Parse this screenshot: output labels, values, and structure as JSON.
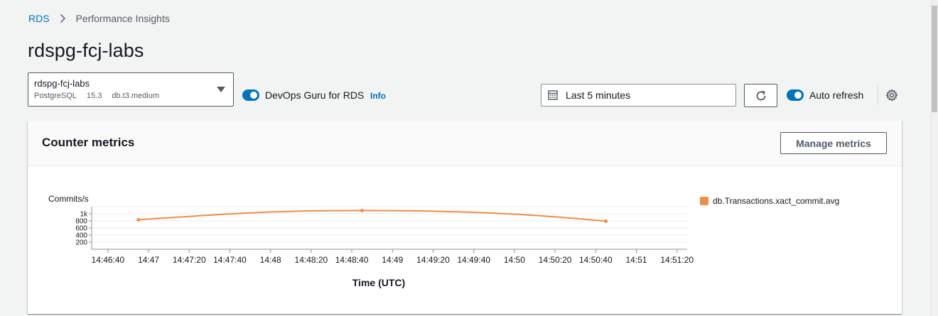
{
  "breadcrumb": {
    "root": "RDS",
    "current": "Performance Insights"
  },
  "page": {
    "title": "rdspg-fcj-labs"
  },
  "db_selector": {
    "name": "rdspg-fcj-labs",
    "engine": "PostgreSQL",
    "version": "15.3",
    "instance_class": "db.t3.medium"
  },
  "devops_guru": {
    "label": "DevOps Guru for RDS",
    "info": "Info",
    "enabled": true
  },
  "time_range": {
    "label": "Last 5 minutes"
  },
  "auto_refresh": {
    "label": "Auto refresh",
    "enabled": true
  },
  "panel": {
    "title": "Counter metrics",
    "manage_button": "Manage metrics"
  },
  "colors": {
    "accent": "#0073bb",
    "series": "#ec8e4c"
  },
  "chart_data": {
    "type": "line",
    "ylabel": "Commits/s",
    "xlabel": "Time (UTC)",
    "ylim": [
      0,
      1200
    ],
    "yticks": [
      {
        "value": 200,
        "label": "200"
      },
      {
        "value": 400,
        "label": "400"
      },
      {
        "value": 600,
        "label": "600"
      },
      {
        "value": 800,
        "label": "800"
      },
      {
        "value": 1000,
        "label": "1k"
      }
    ],
    "x_range": [
      "14:46:32",
      "14:51:25"
    ],
    "xticks": [
      "14:46:40",
      "14:47",
      "14:47:20",
      "14:47:40",
      "14:48",
      "14:48:20",
      "14:48:40",
      "14:49",
      "14:49:20",
      "14:49:40",
      "14:50",
      "14:50:20",
      "14:50:40",
      "14:51",
      "14:51:20"
    ],
    "grid": true,
    "legend_position": "right",
    "series": [
      {
        "name": "db.Transactions.xact_commit.avg",
        "color": "#ec8e4c",
        "points": [
          {
            "x": "14:46:55",
            "y": 830
          },
          {
            "x": "14:48:45",
            "y": 1090
          },
          {
            "x": "14:50:45",
            "y": 790
          }
        ]
      }
    ]
  }
}
